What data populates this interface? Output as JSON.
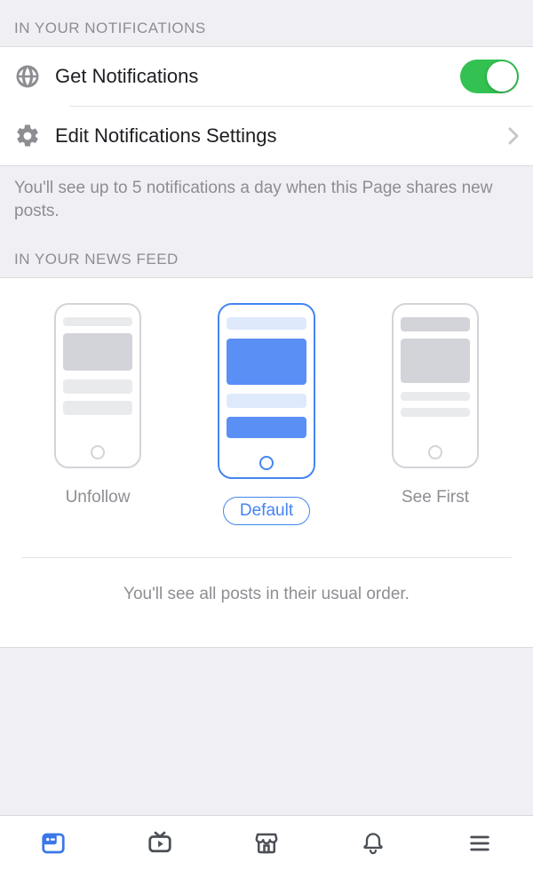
{
  "sections": {
    "notifications_header": "IN YOUR NOTIFICATIONS",
    "newsfeed_header": "IN YOUR NEWS FEED"
  },
  "notifications": {
    "get_label": "Get Notifications",
    "get_enabled": true,
    "edit_label": "Edit Notifications Settings",
    "helper": "You'll see up to 5 notifications a day when this Page shares new posts."
  },
  "newsfeed": {
    "options": [
      {
        "key": "unfollow",
        "label": "Unfollow",
        "selected": false
      },
      {
        "key": "default",
        "label": "Default",
        "selected": true
      },
      {
        "key": "seefirst",
        "label": "See First",
        "selected": false
      }
    ],
    "helper": "You'll see all posts in their usual order."
  },
  "colors": {
    "accent_blue": "#3b77ea",
    "toggle_green": "#33c251"
  },
  "tabbar": {
    "items": [
      "feed",
      "watch",
      "marketplace",
      "notifications",
      "menu"
    ],
    "active_index": 0
  }
}
